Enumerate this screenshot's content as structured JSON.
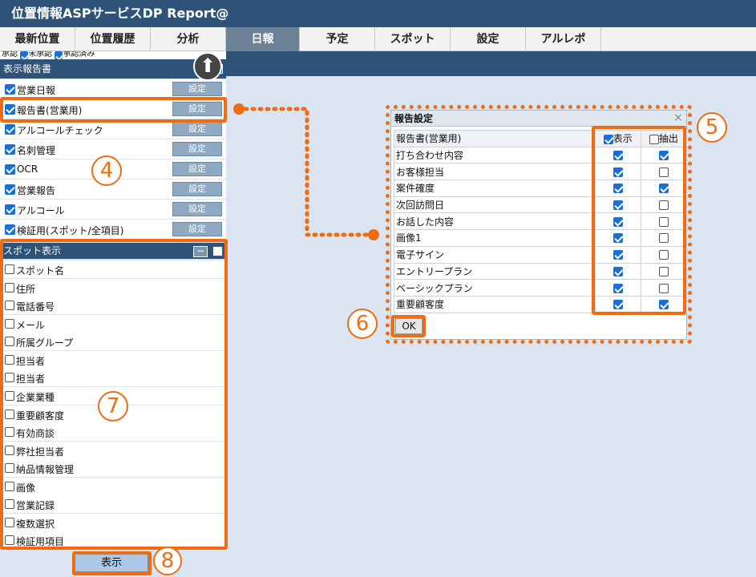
{
  "app": {
    "title": "位置情報ASPサービスDP Report@"
  },
  "nav": {
    "tabs": [
      {
        "label": "最新位置"
      },
      {
        "label": "位置履歴"
      },
      {
        "label": "分析"
      },
      {
        "label": "日報"
      },
      {
        "label": "予定"
      },
      {
        "label": "スポット"
      },
      {
        "label": "設定"
      },
      {
        "label": "アルレポ"
      }
    ]
  },
  "sidebar": {
    "strip": {
      "label1": "承認",
      "label2": "未承認",
      "label3": "承認済み"
    },
    "reports_header": "表示報告書",
    "setting_button": "設定",
    "reports": [
      {
        "label": "営業日報",
        "checked": true
      },
      {
        "label": "報告書(営業用)",
        "checked": true
      },
      {
        "label": "アルコールチェック",
        "checked": true
      },
      {
        "label": "名刺管理",
        "checked": true
      },
      {
        "label": "OCR",
        "checked": true
      },
      {
        "label": "営業報告",
        "checked": true
      },
      {
        "label": "アルコール",
        "checked": true
      },
      {
        "label": "検証用(スポット/全項目)",
        "checked": true
      }
    ],
    "spot_header": "スポット表示",
    "spot_collapse": "−",
    "spots": [
      {
        "label": "スポット名"
      },
      {
        "label": "住所"
      },
      {
        "label": "電話番号"
      },
      {
        "label": "メール"
      },
      {
        "label": "所属グループ"
      },
      {
        "label": "担当者"
      },
      {
        "label": "担当者"
      },
      {
        "label": "企業業種"
      },
      {
        "label": "重要顧客度"
      },
      {
        "label": "有効商談"
      },
      {
        "label": "弊社担当者"
      },
      {
        "label": "納品情報管理"
      },
      {
        "label": "画像"
      },
      {
        "label": "営業記録"
      },
      {
        "label": "複数選択"
      },
      {
        "label": "検証用項目"
      }
    ],
    "show_button": "表示"
  },
  "dialog": {
    "title": "報告設定",
    "close": "×",
    "header_name": "報告書(営業用)",
    "col_show": "表示",
    "col_extract": "抽出",
    "rows": [
      {
        "label": "打ち合わせ内容",
        "show": true,
        "extract": true
      },
      {
        "label": "お客様担当",
        "show": true,
        "extract": false
      },
      {
        "label": "案件確度",
        "show": true,
        "extract": true
      },
      {
        "label": "次回訪問日",
        "show": true,
        "extract": false
      },
      {
        "label": "お話した内容",
        "show": true,
        "extract": false
      },
      {
        "label": "画像1",
        "show": true,
        "extract": false
      },
      {
        "label": "電子サイン",
        "show": true,
        "extract": false
      },
      {
        "label": "エントリープラン",
        "show": true,
        "extract": false
      },
      {
        "label": "ベーシックプラン",
        "show": true,
        "extract": false
      },
      {
        "label": "重要顧客度",
        "show": true,
        "extract": true
      }
    ],
    "ok": "OK"
  },
  "annotations": {
    "n4": "4",
    "n5": "5",
    "n6": "6",
    "n7": "7",
    "n8": "8"
  },
  "colors": {
    "accent": "#f06c12",
    "header": "#2f5378",
    "panel": "#dbe5f1",
    "checkbox": "#1a6fd6"
  }
}
